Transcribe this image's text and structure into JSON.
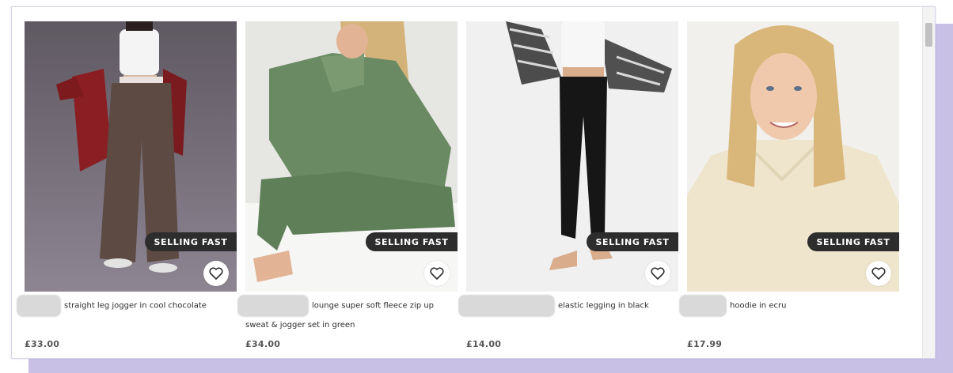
{
  "products": [
    {
      "badge": "SELLING FAST",
      "title": "straight leg jogger in cool chocolate",
      "price": "£33.00",
      "wishlist_icon": "heart-icon",
      "colors": {
        "bg": "#6e6670",
        "garment": "#5b4a45"
      }
    },
    {
      "badge": "SELLING FAST",
      "title": "lounge super soft fleece zip up sweat & jogger set in green",
      "price": "£34.00",
      "wishlist_icon": "heart-icon",
      "colors": {
        "bg": "#e9e9e6",
        "garment": "#6b8a63"
      }
    },
    {
      "badge": "SELLING FAST",
      "title": "elastic legging in black",
      "price": "£14.00",
      "wishlist_icon": "heart-icon",
      "colors": {
        "bg": "#f1f1f1",
        "garment": "#1c1c1c"
      }
    },
    {
      "badge": "SELLING FAST",
      "title": "hoodie in ecru",
      "price": "£17.99",
      "wishlist_icon": "heart-icon",
      "colors": {
        "bg": "#f3f2ef",
        "garment": "#efe6cf"
      }
    }
  ]
}
